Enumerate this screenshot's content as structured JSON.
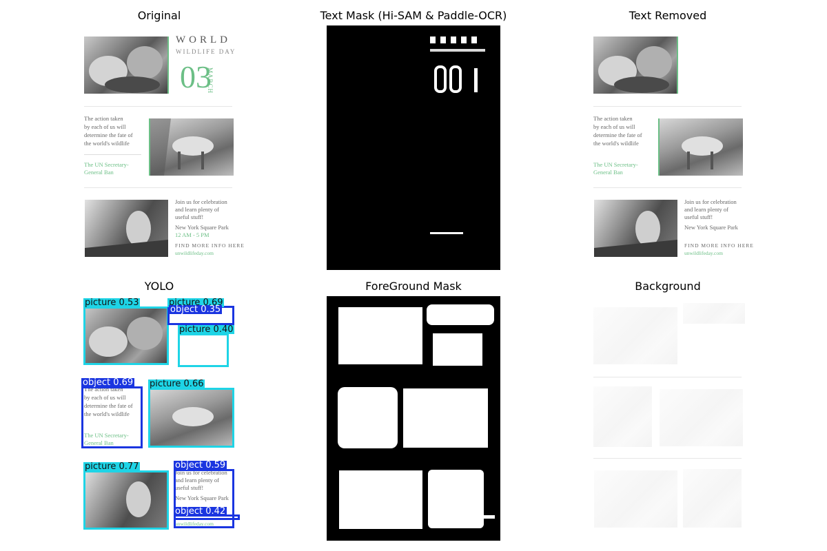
{
  "panels": {
    "original": "Original",
    "text_mask": "Text Mask (Hi-SAM & Paddle-OCR)",
    "text_removed": "Text Removed",
    "yolo": "YOLO",
    "foreground_mask": "ForeGround Mask",
    "background": "Background"
  },
  "poster": {
    "world": "WORLD",
    "wildlife_day": "WILDLIFE DAY",
    "day_number": "03",
    "month": "MARCH",
    "quote_lines": [
      "The action taken",
      "by each of us will",
      "determine the fate of",
      "the world's wildlife"
    ],
    "author_lines": [
      "The UN Secretary-",
      "General Ban"
    ],
    "invite_lines": [
      "Join us for celebration",
      "and learn plenty of",
      "useful stuff!"
    ],
    "venue": "New York Square Park",
    "hours": "12 AM - 5 PM",
    "find_more": "FIND MORE INFO HERE",
    "website": "unwildlifeday.com"
  },
  "yolo_detections": [
    {
      "class": "picture",
      "score": "0.53",
      "text": "picture 0.53"
    },
    {
      "class": "picture",
      "score": "0.69",
      "text": "picture 0.69"
    },
    {
      "class": "object",
      "score": "0.35",
      "text": "object 0.35"
    },
    {
      "class": "picture",
      "score": "0.40",
      "text": "picture 0.40"
    },
    {
      "class": "object",
      "score": "0.69",
      "text": "object 0.69"
    },
    {
      "class": "picture",
      "score": "0.66",
      "text": "picture 0.66"
    },
    {
      "class": "picture",
      "score": "0.77",
      "text": "picture 0.77"
    },
    {
      "class": "object",
      "score": "0.59",
      "text": "object 0.59"
    },
    {
      "class": "object",
      "score": "0.42",
      "text": "object 0.42"
    }
  ],
  "colors": {
    "accent_green": "#6cbf86",
    "picture_box": "#1ed4e6",
    "object_box": "#1a35e0",
    "mask_bg": "#000000",
    "mask_fg": "#ffffff"
  }
}
